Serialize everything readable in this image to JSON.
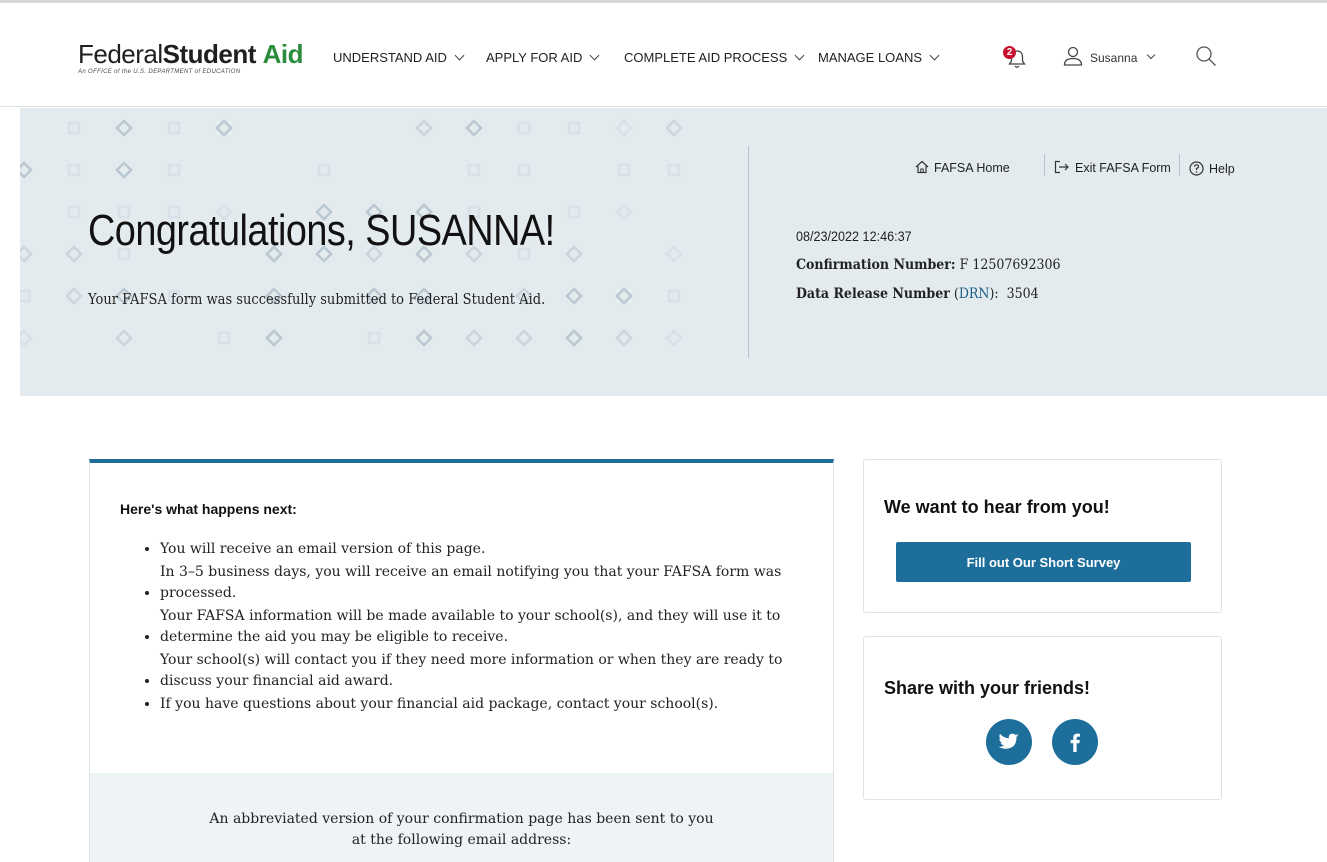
{
  "header": {
    "logo": {
      "word1": "Federal",
      "word2": "Student",
      "word3": "Aid",
      "subtitle": "An OFFICE of the U.S. DEPARTMENT of EDUCATION"
    },
    "nav": [
      {
        "label": "UNDERSTAND AID"
      },
      {
        "label": "APPLY FOR AID"
      },
      {
        "label": "COMPLETE AID PROCESS"
      },
      {
        "label": "MANAGE LOANS"
      }
    ],
    "notification_count": "2",
    "user_name": "Susanna"
  },
  "banner": {
    "util_links": {
      "home": "FAFSA Home",
      "exit": "Exit FAFSA Form",
      "help": "Help"
    },
    "title": "Congratulations, SUSANNA!",
    "subtitle": "Your FAFSA form was successfully submitted to Federal Student Aid.",
    "timestamp": "08/23/2022 12:46:37",
    "confirmation_label": "Confirmation Number:",
    "confirmation_value": "F 12507692306",
    "drn_label": "Data Release Number",
    "drn_link": "DRN",
    "drn_value": "3504"
  },
  "main": {
    "heading": "Here's what happens next:",
    "items": [
      "You will receive an email version of this page.",
      "In 3–5 business days, you will receive an email notifying you that your FAFSA form was processed.",
      "Your FAFSA information will be made available to your school(s), and they will use it to determine the aid you may be eligible to receive.",
      "Your school(s) will contact you if they need more information or when they are ready to discuss your financial aid award.",
      "If you have questions about your financial aid package, contact your school(s)."
    ],
    "email_line1": "An abbreviated version of your confirmation page has been sent to you",
    "email_line2": "at the following email address:"
  },
  "sidebar": {
    "survey_title": "We want to hear from you!",
    "survey_button": "Fill out Our Short Survey",
    "share_title": "Share with your friends!",
    "social_icons": [
      "twitter-icon",
      "facebook-icon"
    ]
  },
  "colors": {
    "brand_green": "#2a8c3c",
    "primary_blue": "#1d6e9b",
    "banner_bg": "#e4ebef",
    "alert_red": "#c8102e"
  }
}
